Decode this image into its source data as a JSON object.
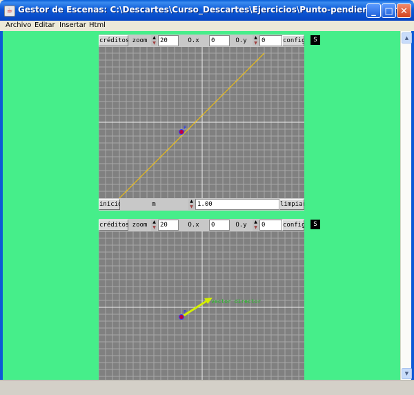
{
  "window": {
    "title": "Gestor de Escenas: C:\\Descartes\\Curso_Descartes\\Ejercicios\\Punto-pendiente.htm",
    "icon": "java-cup-icon",
    "controls": {
      "minimize": "_",
      "maximize": "□",
      "close": "✕"
    }
  },
  "menu": [
    "Archivo",
    "Editar",
    "Insertar",
    "Html"
  ],
  "scene1": {
    "toolbar": {
      "creditos": "créditos",
      "zoom_label": "zoom",
      "zoom": "20",
      "ox_label": "O.x",
      "ox": "0",
      "oy_label": "O.y",
      "oy": "0",
      "config": "config",
      "s": "S"
    },
    "point_label": "P",
    "bottom": {
      "inicio": "inicio",
      "m_label": "m",
      "m_value": "1.00",
      "limpiar": "limpiar"
    }
  },
  "scene2": {
    "toolbar": {
      "creditos": "créditos",
      "zoom_label": "zoom",
      "zoom": "20",
      "ox_label": "O.x",
      "ox": "0",
      "oy_label": "O.y",
      "oy": "0",
      "config": "config",
      "s": "S"
    },
    "point_label": "P",
    "vector_label": "vector director"
  },
  "colors": {
    "canvas": "#46ee8a",
    "scene": "#808080",
    "line": "#ffc800",
    "point": "#c00040",
    "vector": "#d4f000"
  }
}
